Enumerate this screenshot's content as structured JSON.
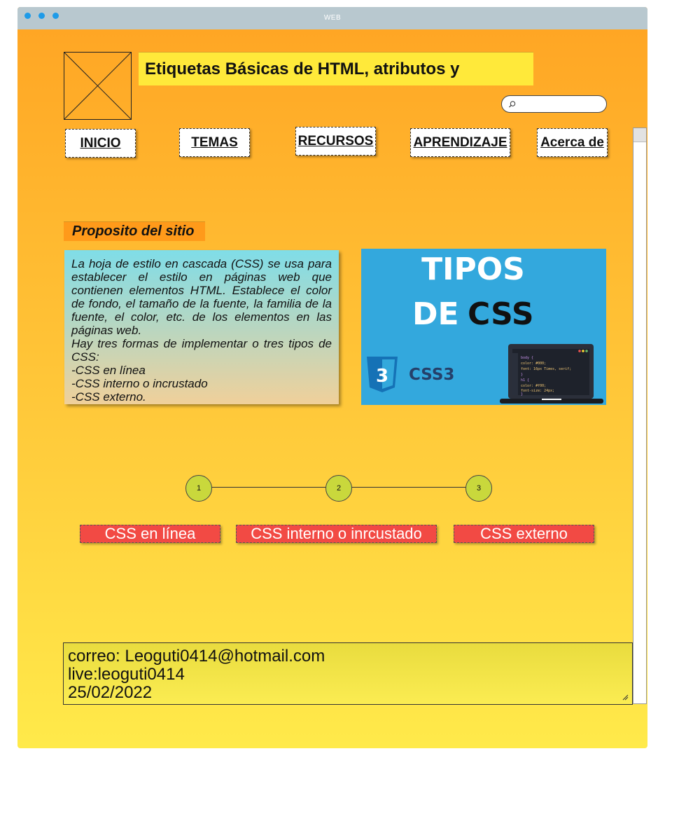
{
  "window": {
    "title": "WEB"
  },
  "header": {
    "title": "Etiquetas Básicas de HTML, atributos y",
    "search_placeholder": ""
  },
  "nav": [
    {
      "label": "INICIO"
    },
    {
      "label": "TEMAS"
    },
    {
      "label": "RECURSOS "
    },
    {
      "label": "APRENDIZAJE"
    },
    {
      "label": "Acerca de"
    }
  ],
  "main": {
    "section_title": "Proposito del sitio",
    "description": [
      "La hoja de estilo en cascada (CSS) se usa para establecer el estilo en páginas web que contienen elementos HTML. Establece el color de fondo, el tamaño de la fuente, la familia de la fuente, el color, etc. de los elementos en las páginas web.",
      "Hay tres formas de implementar o tres tipos de CSS:",
      "-CSS en línea",
      "-CSS interno o incrustado",
      "-CSS externo."
    ],
    "image": {
      "line1": "TIPOS",
      "line2a": "DE",
      "line2b": "CSS",
      "logo_number": "3",
      "logo_text": "CSS3",
      "code": [
        "body {",
        "  color: #000;",
        "  font: 16px Times, serif;",
        "}",
        "h1 {",
        "  color: #f00;",
        "  font-size: 24px;",
        "}"
      ]
    }
  },
  "steps": [
    {
      "number": "1"
    },
    {
      "number": "2"
    },
    {
      "number": "3"
    }
  ],
  "types": [
    {
      "label": "CSS en línea"
    },
    {
      "label": "CSS interno o inrcustado"
    },
    {
      "label": "CSS externo"
    }
  ],
  "footer": {
    "email": "correo: Leoguti0414@hotmail.com",
    "live": "live:leoguti0414",
    "date": "25/02/2022"
  },
  "colors": {
    "background_top": "#ffa423",
    "background_bottom": "#ffea4a",
    "title_bar": "#b8c8cf",
    "window_dots": "#1e9be8",
    "type_buttons": "#f24a44",
    "steps": "#c9d83c"
  }
}
